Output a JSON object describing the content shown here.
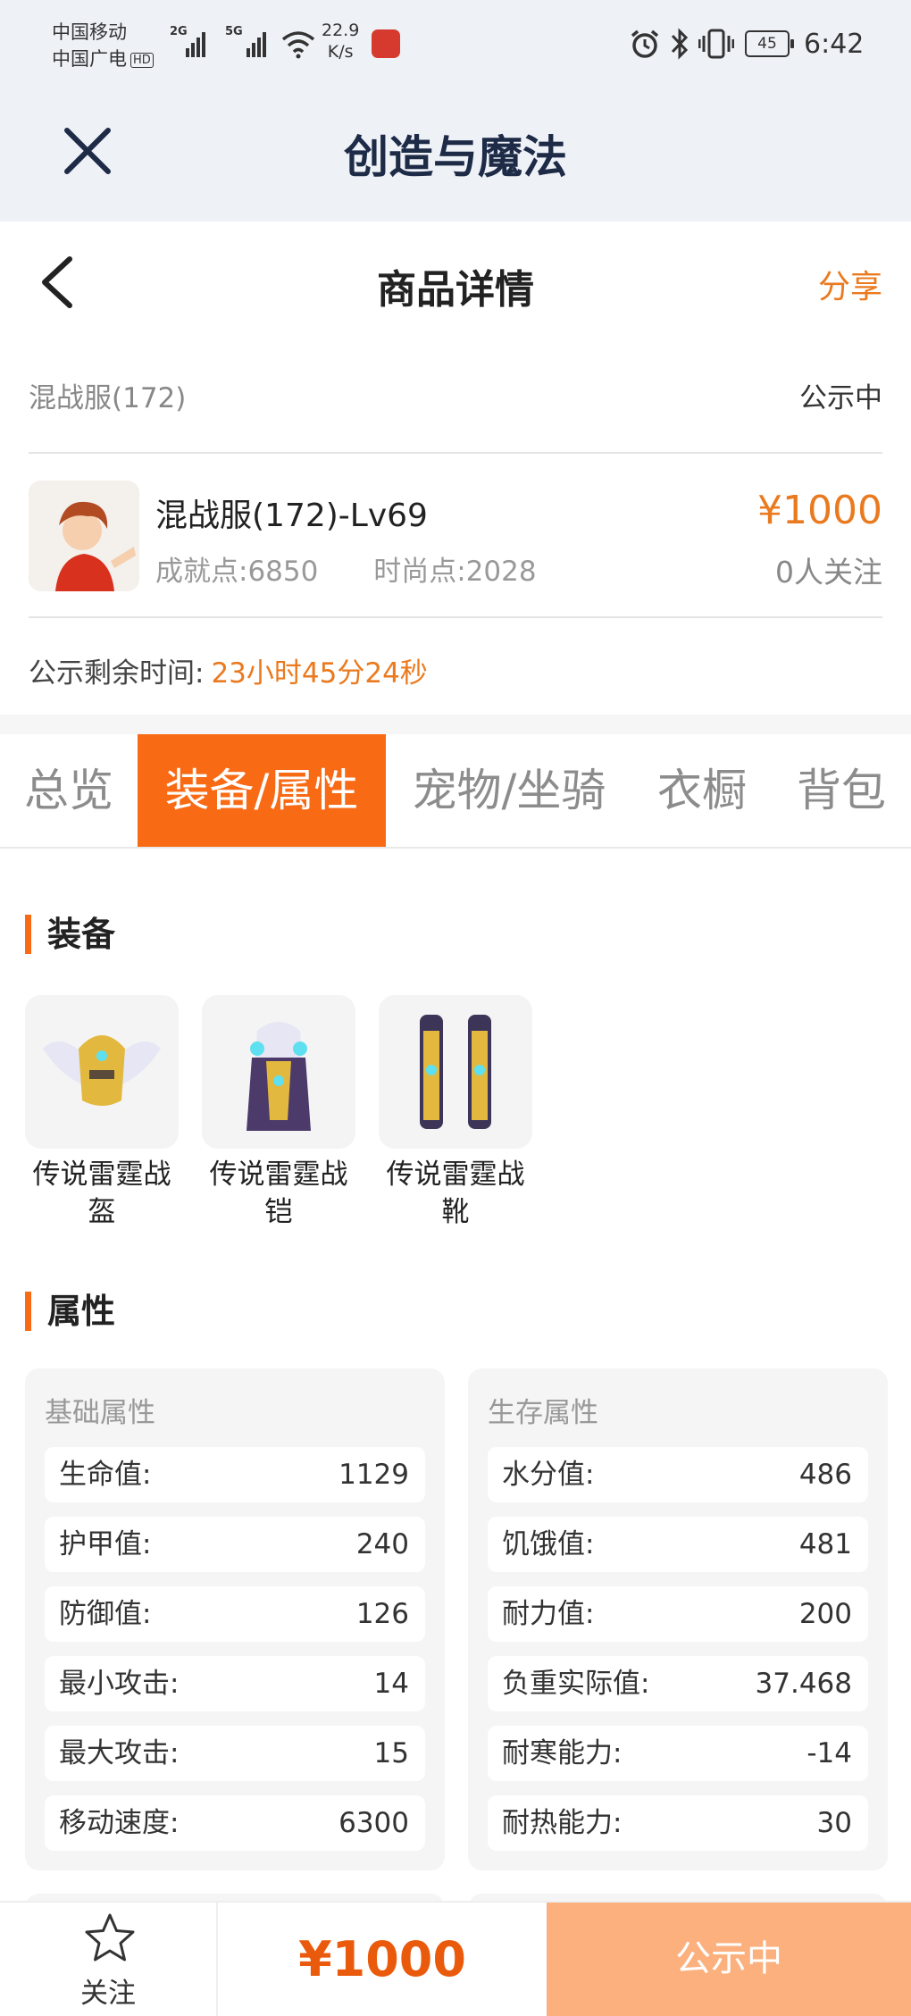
{
  "status_bar": {
    "carrier1": "中国移动",
    "carrier2": "中国广电",
    "hd": "HD",
    "signal1": "2G",
    "signal2": "5G",
    "speed_value": "22.9",
    "speed_unit": "K/s",
    "battery": "45",
    "time": "6:42"
  },
  "app": {
    "title": "创造与魔法"
  },
  "nav": {
    "title": "商品详情",
    "share": "分享"
  },
  "listing": {
    "server": "混战服(172)",
    "status": "公示中",
    "item_name": "混战服(172)-Lv69",
    "achievement": "成就点:6850",
    "fashion": "时尚点:2028",
    "price": "¥1000",
    "followers": "0人关注",
    "timer_label": "公示剩余时间:",
    "timer_value": "23小时45分24秒"
  },
  "tabs": [
    {
      "label": "总览",
      "active": false
    },
    {
      "label": "装备/属性",
      "active": true
    },
    {
      "label": "宠物/坐骑",
      "active": false
    },
    {
      "label": "衣橱",
      "active": false
    },
    {
      "label": "背包",
      "active": false
    }
  ],
  "equipment": {
    "heading": "装备",
    "items": [
      {
        "name": "传说雷霆战盔"
      },
      {
        "name": "传说雷霆战铠"
      },
      {
        "name": "传说雷霆战靴"
      }
    ]
  },
  "attributes": {
    "heading": "属性",
    "basic": {
      "title": "基础属性",
      "rows": [
        {
          "k": "生命值:",
          "v": "1129"
        },
        {
          "k": "护甲值:",
          "v": "240"
        },
        {
          "k": "防御值:",
          "v": "126"
        },
        {
          "k": "最小攻击:",
          "v": "14"
        },
        {
          "k": "最大攻击:",
          "v": "15"
        },
        {
          "k": "移动速度:",
          "v": "6300"
        }
      ]
    },
    "survival": {
      "title": "生存属性",
      "rows": [
        {
          "k": "水分值:",
          "v": "486"
        },
        {
          "k": "饥饿值:",
          "v": "481"
        },
        {
          "k": "耐力值:",
          "v": "200"
        },
        {
          "k": "负重实际值:",
          "v": "37.468"
        },
        {
          "k": "耐寒能力:",
          "v": "-14"
        },
        {
          "k": "耐热能力:",
          "v": "30"
        }
      ]
    }
  },
  "bottom_bar": {
    "follow": "关注",
    "price": "¥1000",
    "status": "公示中"
  },
  "colors": {
    "accent": "#f96a14",
    "price": "#ea7a1f",
    "status_button": "#fbb07e"
  }
}
